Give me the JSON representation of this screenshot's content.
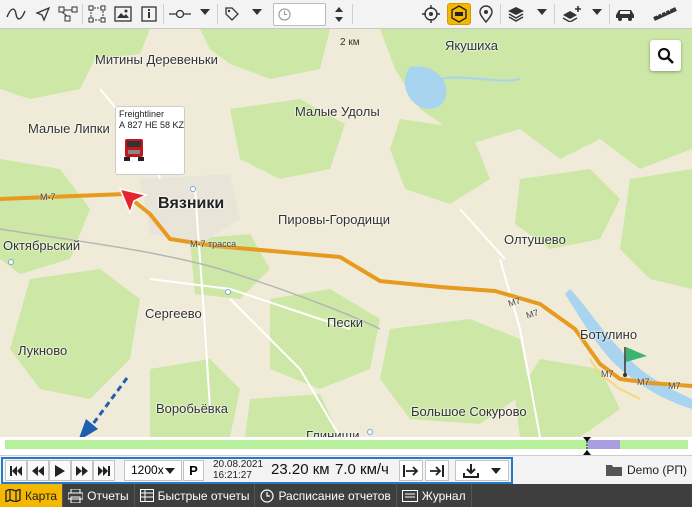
{
  "colors": {
    "accent": "#f5b800",
    "route": "#e89a1e",
    "highlight_border": "#2878c8",
    "track": "#b7f09a",
    "water": "#a8d4f0",
    "forest": "#cce7a6"
  },
  "toolbar": {
    "icons": [
      "curve-icon",
      "arrow-icon",
      "nodes-icon",
      "select-area-icon",
      "image-icon",
      "info-icon",
      "point-line-icon",
      "tag-icon",
      "clock-icon",
      "crosshair-icon",
      "vehicle-focus-icon",
      "location-pin-icon",
      "layers-icon",
      "add-layer-icon",
      "car-icon",
      "ruler-icon"
    ],
    "time_value": ""
  },
  "map": {
    "scale_label": "2 км",
    "places": [
      {
        "name": "Якушиха"
      },
      {
        "name": "Митины Деревеньки"
      },
      {
        "name": "Малые Удолы"
      },
      {
        "name": "Малые Липки"
      },
      {
        "name": "Вязники"
      },
      {
        "name": "Пировы-Городищи"
      },
      {
        "name": "Октябрьский"
      },
      {
        "name": "Олтушево"
      },
      {
        "name": "Сергеево"
      },
      {
        "name": "Пески"
      },
      {
        "name": "Ботулино"
      },
      {
        "name": "Лукново"
      },
      {
        "name": "Воробьёвка"
      },
      {
        "name": "Большое Сокурово"
      },
      {
        "name": "Глинищи"
      }
    ],
    "road_labels": [
      "M-7",
      "M-7 трасса",
      "M7",
      "M7",
      "M7",
      "M7",
      "M7"
    ],
    "vehicle": {
      "model": "Freightliner",
      "plate": "А 827 НЕ 58 KZ"
    }
  },
  "playback": {
    "speed_multiplier": "1200x",
    "p_label": "P",
    "date": "20.08.2021",
    "time": "16:21:27",
    "distance": "23.20 км",
    "speed": "7.0 км/ч",
    "account": "Demo (РП)"
  },
  "tabs": [
    {
      "label": "Карта",
      "icon": "map-icon",
      "active": true
    },
    {
      "label": "Отчеты",
      "icon": "print-icon",
      "active": false
    },
    {
      "label": "Быстрые отчеты",
      "icon": "table-icon",
      "active": false
    },
    {
      "label": "Расписание отчетов",
      "icon": "clock-icon",
      "active": false
    },
    {
      "label": "Журнал",
      "icon": "journal-icon",
      "active": false
    }
  ]
}
